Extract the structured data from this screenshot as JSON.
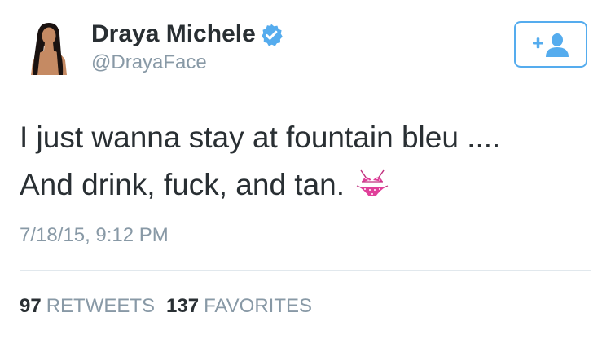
{
  "user": {
    "display_name": "Draya Michele",
    "handle": "@DrayaFace",
    "verified": true
  },
  "follow_button": {
    "icon": "add-user-icon",
    "label": "+"
  },
  "tweet": {
    "text_line1": "I just wanna stay at fountain bleu ....",
    "text_line2": "And drink, fuck, and tan.",
    "emoji": "bikini-icon",
    "timestamp": "7/18/15, 9:12 PM"
  },
  "stats": {
    "retweets_count": "97",
    "retweets_label": "RETWEETS",
    "favorites_count": "137",
    "favorites_label": "FAVORITES"
  },
  "colors": {
    "accent": "#55acee",
    "text": "#292f33",
    "muted": "#8899a6",
    "divider": "#e1e8ed",
    "bikini": "#e0409a"
  }
}
